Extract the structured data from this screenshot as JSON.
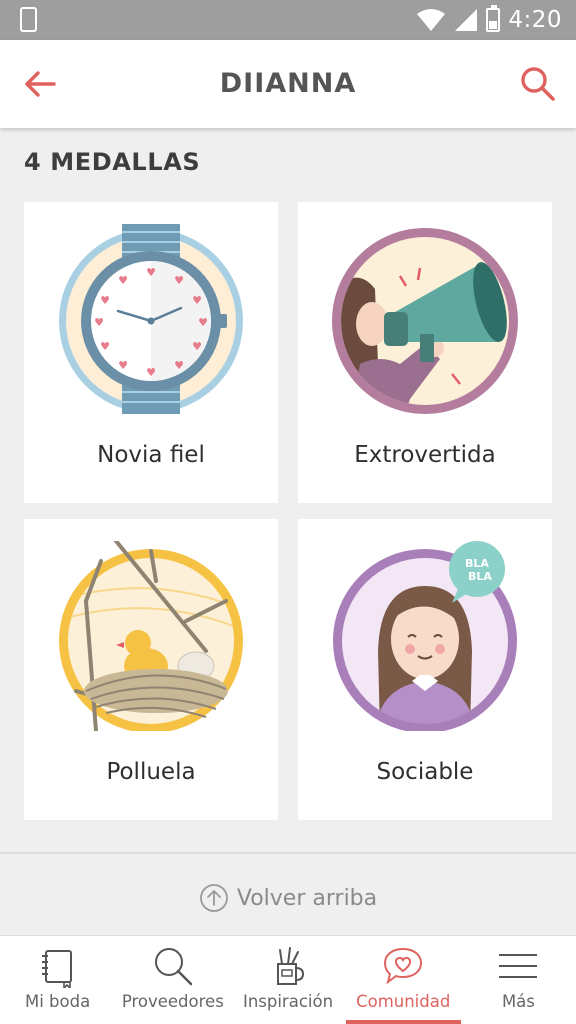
{
  "status_bar": {
    "time": "4:20"
  },
  "app_bar": {
    "title": "DIIANNA"
  },
  "section_title": "4 MEDALLAS",
  "medals": [
    {
      "label": "Novia fiel",
      "icon": "watch-icon"
    },
    {
      "label": "Extrovertida",
      "icon": "megaphone-icon"
    },
    {
      "label": "Polluela",
      "icon": "chick-nest-icon"
    },
    {
      "label": "Sociable",
      "icon": "girl-bla-bla-icon",
      "bubble_line1": "BLA",
      "bubble_line2": "BLA"
    }
  ],
  "back_to_top": "Volver arriba",
  "bottom_nav": [
    {
      "label": "Mi boda",
      "icon": "notebook-icon"
    },
    {
      "label": "Proveedores",
      "icon": "search-icon"
    },
    {
      "label": "Inspiración",
      "icon": "pencil-cup-icon"
    },
    {
      "label": "Comunidad",
      "icon": "heart-chat-icon",
      "active": true
    },
    {
      "label": "Más",
      "icon": "menu-icon"
    }
  ],
  "colors": {
    "accent": "#e0625f",
    "background": "#efefef"
  }
}
